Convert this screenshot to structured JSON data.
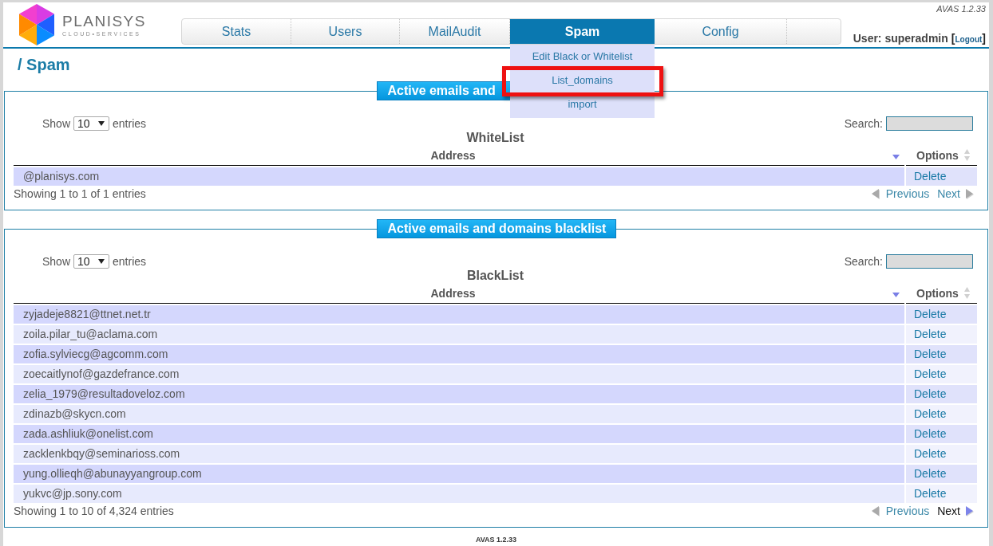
{
  "header": {
    "logo": {
      "name": "PLANISYS",
      "tagline": "CLOUD•SERVICES"
    },
    "version": "AVAS 1.2.33",
    "user": {
      "label": "User: superadmin",
      "bracket_open": "[",
      "logout": "Logout",
      "bracket_close": "]"
    }
  },
  "nav": {
    "tabs": [
      {
        "label": "Stats",
        "selected": false
      },
      {
        "label": "Users",
        "selected": false
      },
      {
        "label": "MailAudit",
        "selected": false
      },
      {
        "label": "Spam",
        "selected": true
      },
      {
        "label": "Config",
        "selected": false
      }
    ],
    "dropdown": {
      "items": [
        {
          "label": "Edit Black or Whitelist",
          "highlighted": false
        },
        {
          "label": "List_domains",
          "highlighted": true
        },
        {
          "label": "import",
          "highlighted": false
        }
      ]
    }
  },
  "page_title": "/ Spam",
  "panels": [
    {
      "legend": "Active emails and",
      "length": {
        "show": "Show",
        "value": "10",
        "entries": "entries"
      },
      "search": {
        "label": "Search:"
      },
      "title": "WhiteList",
      "columns": [
        {
          "label": "Address",
          "sorted": true
        },
        {
          "label": "Options",
          "sorted": false
        }
      ],
      "rows": [
        {
          "address": "@planisys.com",
          "action": "Delete"
        }
      ],
      "info": "Showing 1 to 1 of 1 entries",
      "pagination": {
        "previous": {
          "label": "Previous",
          "disabled": true
        },
        "next": {
          "label": "Next",
          "disabled": true
        }
      }
    },
    {
      "legend": "Active emails and domains blacklist",
      "length": {
        "show": "Show",
        "value": "10",
        "entries": "entries"
      },
      "search": {
        "label": "Search:"
      },
      "title": "BlackList",
      "columns": [
        {
          "label": "Address",
          "sorted": true
        },
        {
          "label": "Options",
          "sorted": false
        }
      ],
      "rows": [
        {
          "address": "zyjadeje8821@ttnet.net.tr",
          "action": "Delete"
        },
        {
          "address": "zoila.pilar_tu@aclama.com",
          "action": "Delete"
        },
        {
          "address": "zofia.sylviecg@agcomm.com",
          "action": "Delete"
        },
        {
          "address": "zoecaitlynof@gazdefrance.com",
          "action": "Delete"
        },
        {
          "address": "zelia_1979@resultadoveloz.com",
          "action": "Delete"
        },
        {
          "address": "zdinazb@skycn.com",
          "action": "Delete"
        },
        {
          "address": "zada.ashliuk@onelist.com",
          "action": "Delete"
        },
        {
          "address": "zacklenkbqy@seminarioss.com",
          "action": "Delete"
        },
        {
          "address": "yung.ollieqh@abunayyangroup.com",
          "action": "Delete"
        },
        {
          "address": "yukvc@jp.sony.com",
          "action": "Delete"
        }
      ],
      "info": "Showing 1 to 10 of 4,324 entries",
      "pagination": {
        "previous": {
          "label": "Previous",
          "disabled": true
        },
        "next": {
          "label": "Next",
          "disabled": false
        }
      }
    }
  ],
  "footer": {
    "version": "AVAS 1.2.33"
  }
}
